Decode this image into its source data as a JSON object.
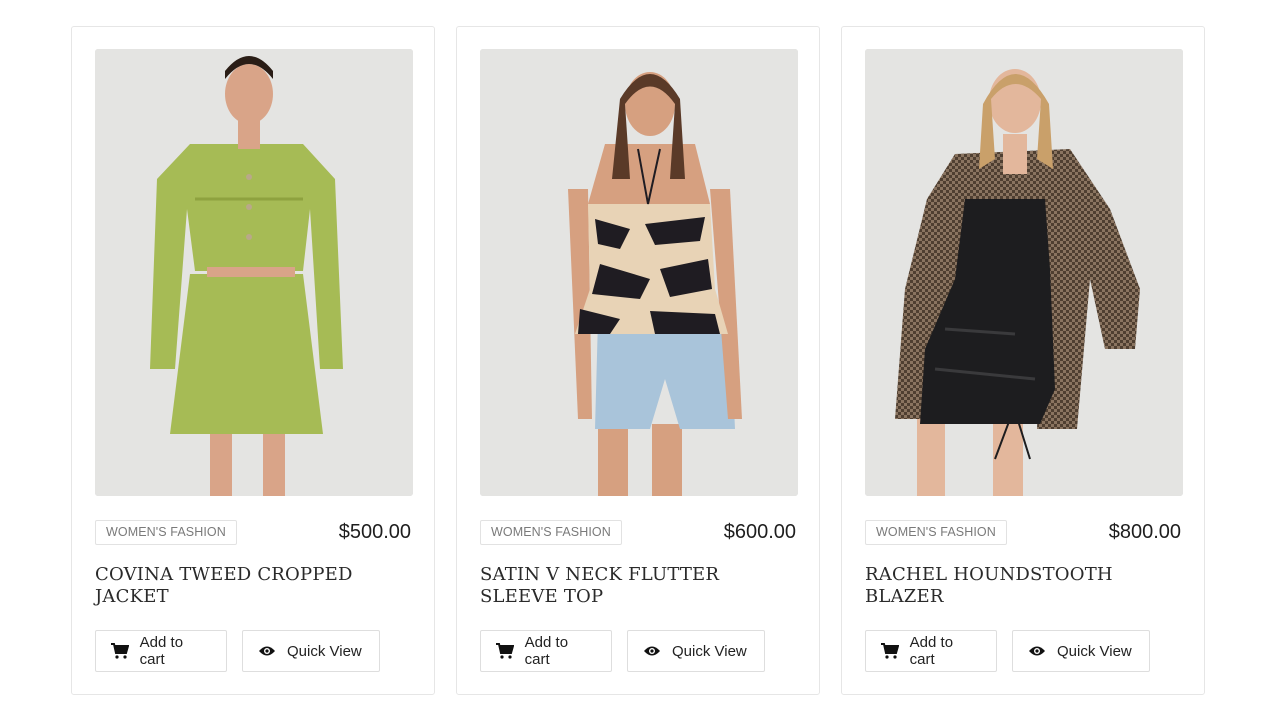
{
  "products": [
    {
      "category": "WOMEN'S FASHION",
      "price": "$500.00",
      "title": "COVINA TWEED CROPPED JACKET",
      "add_to_cart": "Add to cart",
      "quick_view": "Quick View",
      "colors": {
        "garment": "#a6bb55",
        "garment_shade": "#8ea23f",
        "skin": "#d9a488",
        "hair": "#2a1d16"
      }
    },
    {
      "category": "WOMEN'S FASHION",
      "price": "$600.00",
      "title": "SATIN V NECK FLUTTER SLEEVE TOP",
      "add_to_cart": "Add to cart",
      "quick_view": "Quick View",
      "colors": {
        "garment": "#e8d3b6",
        "garment_pattern": "#1f1c22",
        "shorts": "#a9c4da",
        "skin": "#d6a080",
        "hair": "#5a3a28"
      }
    },
    {
      "category": "WOMEN'S FASHION",
      "price": "$800.00",
      "title": "RACHEL HOUNDSTOOTH BLAZER",
      "add_to_cart": "Add to cart",
      "quick_view": "Quick View",
      "colors": {
        "garment": "#6f5a47",
        "inner": "#1d1d1f",
        "skin": "#e3b79c",
        "hair": "#c9a06a"
      }
    }
  ],
  "icons": {
    "cart": "cart-icon",
    "eye": "eye-icon"
  }
}
